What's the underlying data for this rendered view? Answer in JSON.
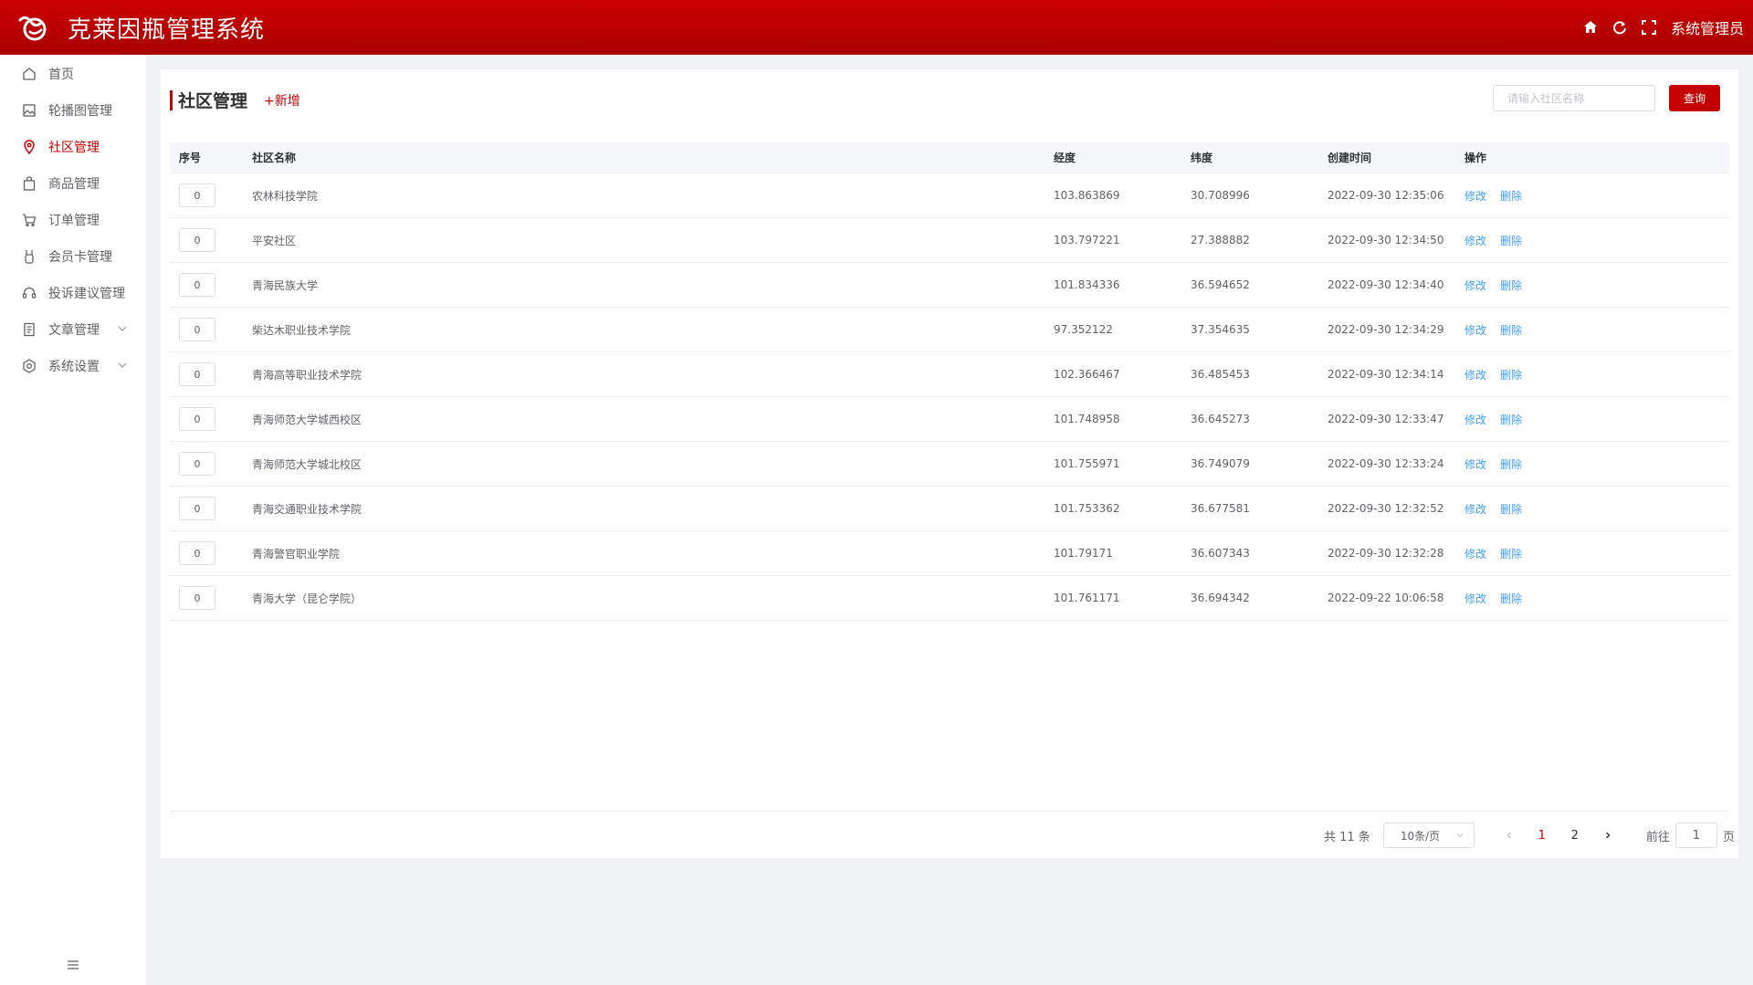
{
  "header": {
    "title": "克莱因瓶管理系统",
    "user": "系统管理员",
    "brand_color": "#c40000",
    "icons": [
      "home-icon",
      "refresh-icon",
      "fullscreen-icon"
    ]
  },
  "sidebar": {
    "items": [
      {
        "label": "首页",
        "icon": "home-icon"
      },
      {
        "label": "轮播图管理",
        "icon": "image-icon"
      },
      {
        "label": "社区管理",
        "icon": "location-icon",
        "active": true
      },
      {
        "label": "商品管理",
        "icon": "bag-icon"
      },
      {
        "label": "订单管理",
        "icon": "cart-icon"
      },
      {
        "label": "会员卡管理",
        "icon": "medal-icon"
      },
      {
        "label": "投诉建议管理",
        "icon": "headset-icon"
      },
      {
        "label": "文章管理",
        "icon": "document-icon",
        "expandable": true
      },
      {
        "label": "系统设置",
        "icon": "settings-icon",
        "expandable": true
      }
    ],
    "collapse_icon": "menu-collapse-icon"
  },
  "main": {
    "title": "社区管理",
    "add_label": "+新增",
    "search": {
      "placeholder": "请输入社区名称",
      "value": ""
    },
    "search_button": "查询",
    "table": {
      "columns": [
        "序号",
        "社区名称",
        "经度",
        "纬度",
        "创建时间",
        "操作"
      ],
      "rows": [
        {
          "order": "0",
          "name": "农林科技学院",
          "lng": "103.863869",
          "lat": "30.708996",
          "created": "2022-09-30 12:35:06"
        },
        {
          "order": "0",
          "name": "平安社区",
          "lng": "103.797221",
          "lat": "27.388882",
          "created": "2022-09-30 12:34:50"
        },
        {
          "order": "0",
          "name": "青海民族大学",
          "lng": "101.834336",
          "lat": "36.594652",
          "created": "2022-09-30 12:34:40"
        },
        {
          "order": "0",
          "name": "柴达木职业技术学院",
          "lng": "97.352122",
          "lat": "37.354635",
          "created": "2022-09-30 12:34:29"
        },
        {
          "order": "0",
          "name": "青海高等职业技术学院",
          "lng": "102.366467",
          "lat": "36.485453",
          "created": "2022-09-30 12:34:14"
        },
        {
          "order": "0",
          "name": "青海师范大学城西校区",
          "lng": "101.748958",
          "lat": "36.645273",
          "created": "2022-09-30 12:33:47"
        },
        {
          "order": "0",
          "name": "青海师范大学城北校区",
          "lng": "101.755971",
          "lat": "36.749079",
          "created": "2022-09-30 12:33:24"
        },
        {
          "order": "0",
          "name": "青海交通职业技术学院",
          "lng": "101.753362",
          "lat": "36.677581",
          "created": "2022-09-30 12:32:52"
        },
        {
          "order": "0",
          "name": "青海警官职业学院",
          "lng": "101.79171",
          "lat": "36.607343",
          "created": "2022-09-30 12:32:28"
        },
        {
          "order": "0",
          "name": "青海大学（昆仑学院）",
          "lng": "101.761171",
          "lat": "36.694342",
          "created": "2022-09-22 10:06:58"
        }
      ],
      "edit_label": "修改",
      "delete_label": "删除"
    },
    "pagination": {
      "total": "共 11 条",
      "page_size": "10条/页",
      "pages": [
        "1",
        "2"
      ],
      "current": "1",
      "goto_label": "前往",
      "goto_value": "1",
      "page_suffix": "页"
    }
  }
}
